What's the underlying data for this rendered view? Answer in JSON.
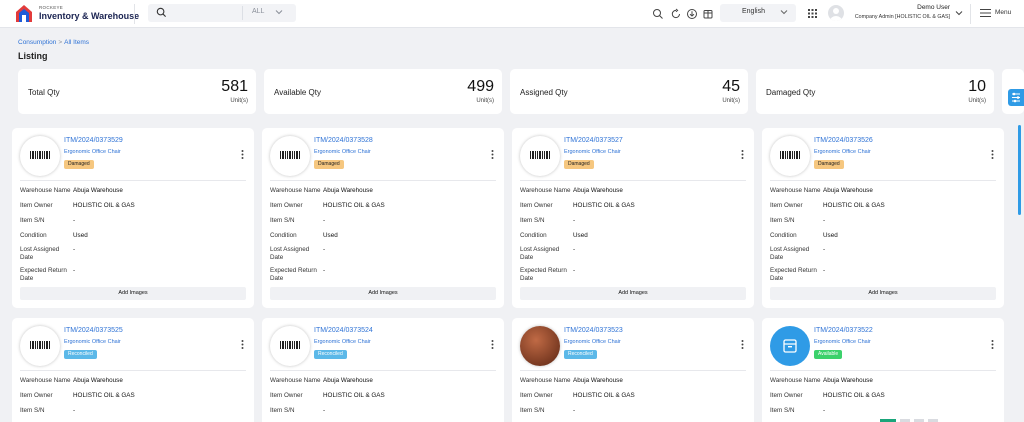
{
  "header": {
    "brand_small": "ROCKEYE",
    "brand_name": "Inventory & Warehouse",
    "search_scope": "ALL",
    "language": "English",
    "user_name": "Demo User",
    "user_role": "Company Admin [HOLISTIC OIL & GAS]",
    "menu_label": "Menu",
    "icons": [
      "search-icon",
      "refresh-icon",
      "download-icon",
      "calendar-icon"
    ]
  },
  "breadcrumb": {
    "root": "Consumption",
    "sep": ">",
    "current": "All Items"
  },
  "page_title": "Listing",
  "stats": [
    {
      "label": "Total Qty",
      "value": "581",
      "unit": "Unit(s)"
    },
    {
      "label": "Available Qty",
      "value": "499",
      "unit": "Unit(s)"
    },
    {
      "label": "Assigned Qty",
      "value": "45",
      "unit": "Unit(s)"
    },
    {
      "label": "Damaged Qty",
      "value": "10",
      "unit": "Unit(s)"
    }
  ],
  "field_labels": {
    "warehouse": "Warehouse Name",
    "owner": "Item Owner",
    "sn": "Item S/N",
    "condition": "Condition",
    "last_assigned_1": "Lost Assigned",
    "last_assigned_2": "Date",
    "expected_1": "Expected Return",
    "expected_2": "Date"
  },
  "add_images_label": "Add Images",
  "colors": {
    "damaged": "#f6c77f",
    "reconciled": "#5bb8e8",
    "available": "#3bd16b",
    "link": "#2f73d6"
  },
  "cards": [
    {
      "code": "ITM/2024/0373529",
      "name": "Ergonomic Office Chair",
      "status": "Damaged",
      "warehouse": "Abuja Warehouse",
      "owner": "HOLISTIC OIL & GAS",
      "sn": "-",
      "condition": "Used",
      "last_assigned": "-",
      "expected_return": "-",
      "thumb": "barcode"
    },
    {
      "code": "ITM/2024/0373528",
      "name": "Ergonomic Office Chair",
      "status": "Damaged",
      "warehouse": "Abuja Warehouse",
      "owner": "HOLISTIC OIL & GAS",
      "sn": "-",
      "condition": "Used",
      "last_assigned": "-",
      "expected_return": "-",
      "thumb": "barcode"
    },
    {
      "code": "ITM/2024/0373527",
      "name": "Ergonomic Office Chair",
      "status": "Damaged",
      "warehouse": "Abuja Warehouse",
      "owner": "HOLISTIC OIL & GAS",
      "sn": "-",
      "condition": "Used",
      "last_assigned": "-",
      "expected_return": "-",
      "thumb": "barcode"
    },
    {
      "code": "ITM/2024/0373526",
      "name": "Ergonomic Office Chair",
      "status": "Damaged",
      "warehouse": "Abuja Warehouse",
      "owner": "HOLISTIC OIL & GAS",
      "sn": "-",
      "condition": "Used",
      "last_assigned": "-",
      "expected_return": "-",
      "thumb": "barcode"
    },
    {
      "code": "ITM/2024/0373525",
      "name": "Ergonomic Office Chair",
      "status": "Reconciled",
      "warehouse": "Abuja Warehouse",
      "owner": "HOLISTIC OIL & GAS",
      "sn": "-",
      "thumb": "barcode"
    },
    {
      "code": "ITM/2024/0373524",
      "name": "Ergonomic Office Chair",
      "status": "Reconciled",
      "warehouse": "Abuja Warehouse",
      "owner": "HOLISTIC OIL & GAS",
      "sn": "-",
      "thumb": "barcode"
    },
    {
      "code": "ITM/2024/0373523",
      "name": "Ergonomic Office Chair",
      "status": "Reconciled",
      "warehouse": "Abuja Warehouse",
      "owner": "HOLISTIC OIL & GAS",
      "sn": "-",
      "thumb": "photo"
    },
    {
      "code": "ITM/2024/0373522",
      "name": "Ergonomic Office Chair",
      "status": "Available",
      "warehouse": "Abuja Warehouse",
      "owner": "HOLISTIC OIL & GAS",
      "sn": "-",
      "thumb": "box"
    }
  ]
}
